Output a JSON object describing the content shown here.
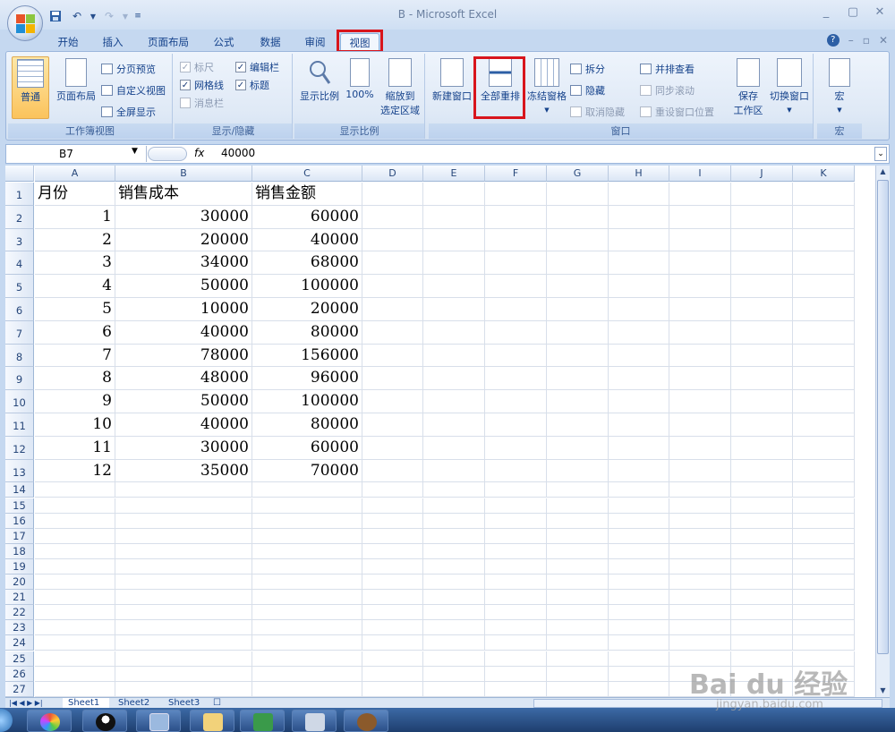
{
  "window": {
    "title": "B - Microsoft Excel",
    "controls": [
      "_",
      "▢",
      "✕"
    ]
  },
  "ribbon_tabs": [
    "开始",
    "插入",
    "页面布局",
    "公式",
    "数据",
    "审阅",
    "视图"
  ],
  "active_tab": "视图",
  "highlight_color": "#d8151c",
  "ribbon": {
    "workbook_views": {
      "label": "工作簿视图",
      "normal": "普通",
      "page_layout": "页面布局",
      "page_break_preview": "分页预览",
      "custom_views": "自定义视图",
      "full_screen": "全屏显示"
    },
    "show_hide": {
      "label": "显示/隐藏",
      "ruler": "标尺",
      "gridlines": "网格线",
      "message_bar": "消息栏",
      "formula_bar": "编辑栏",
      "headings": "标题"
    },
    "zoom": {
      "label": "显示比例",
      "zoom": "显示比例",
      "hundred": "100%",
      "zoom_to_selection_1": "缩放到",
      "zoom_to_selection_2": "选定区域"
    },
    "window": {
      "label": "窗口",
      "new_window": "新建窗口",
      "arrange_all": "全部重排",
      "freeze_panes": "冻结窗格",
      "split": "拆分",
      "hide": "隐藏",
      "unhide": "取消隐藏",
      "side_by_side": "并排查看",
      "sync_scroll": "同步滚动",
      "reset_position": "重设窗口位置",
      "save_workspace_1": "保存",
      "save_workspace_2": "工作区",
      "switch_windows": "切换窗口"
    },
    "macros": {
      "label": "宏",
      "macros": "宏"
    }
  },
  "formula_bar": {
    "name_box": "B7",
    "fx": "fx",
    "value": "40000"
  },
  "columns": [
    "A",
    "B",
    "C",
    "D",
    "E",
    "F",
    "G",
    "H",
    "I",
    "J",
    "K"
  ],
  "headers": {
    "a1": "月份",
    "b1": "销售成本",
    "c1": "销售金额"
  },
  "rows": [
    {
      "month": "1",
      "cost": "30000",
      "sales": "60000"
    },
    {
      "month": "2",
      "cost": "20000",
      "sales": "40000"
    },
    {
      "month": "3",
      "cost": "34000",
      "sales": "68000"
    },
    {
      "month": "4",
      "cost": "50000",
      "sales": "100000"
    },
    {
      "month": "5",
      "cost": "10000",
      "sales": "20000"
    },
    {
      "month": "6",
      "cost": "40000",
      "sales": "80000"
    },
    {
      "month": "7",
      "cost": "78000",
      "sales": "156000"
    },
    {
      "month": "8",
      "cost": "48000",
      "sales": "96000"
    },
    {
      "month": "9",
      "cost": "50000",
      "sales": "100000"
    },
    {
      "month": "10",
      "cost": "40000",
      "sales": "80000"
    },
    {
      "month": "11",
      "cost": "30000",
      "sales": "60000"
    },
    {
      "month": "12",
      "cost": "35000",
      "sales": "70000"
    }
  ],
  "row_numbers": [
    "1",
    "2",
    "3",
    "4",
    "5",
    "6",
    "7",
    "8",
    "9",
    "10",
    "11",
    "12",
    "13",
    "14",
    "15",
    "16",
    "17",
    "18",
    "19",
    "20",
    "21",
    "22",
    "23",
    "24",
    "25",
    "26",
    "27"
  ],
  "sheets": [
    "Sheet1",
    "Sheet2",
    "Sheet3"
  ],
  "watermark": {
    "brand": "Bai du 经验",
    "url": "jingyan.baidu.com"
  }
}
